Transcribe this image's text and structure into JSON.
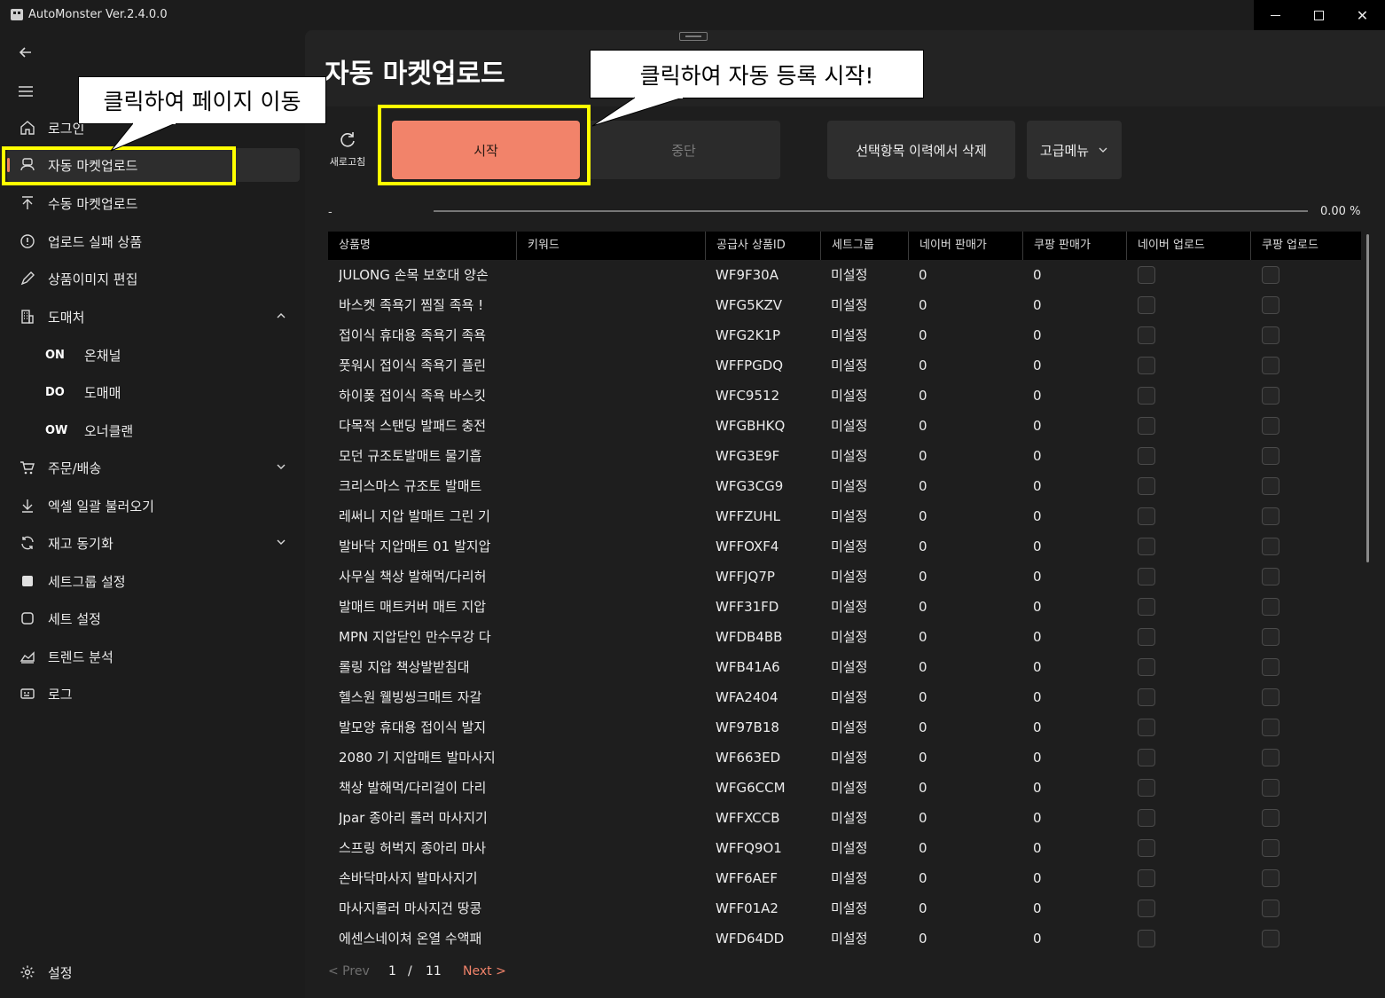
{
  "window": {
    "title": "AutoMonster Ver.2.4.0.0",
    "minimize": "",
    "maximize": "",
    "close": "✕"
  },
  "sidebar": {
    "items": [
      {
        "label": "로그인",
        "icon": "home-icon"
      },
      {
        "label": "자동 마켓업로드",
        "icon": "auto-upload-icon"
      },
      {
        "label": "수동 마켓업로드",
        "icon": "upload-arrow-icon"
      },
      {
        "label": "업로드 실패 상품",
        "icon": "alert-circle-icon"
      },
      {
        "label": "상품이미지 편집",
        "icon": "pencil-icon"
      },
      {
        "label": "도매처",
        "icon": "building-icon"
      },
      {
        "label": "주문/배송",
        "icon": "cart-icon"
      },
      {
        "label": "엑셀 일괄 불러오기",
        "icon": "download-arrow-icon"
      },
      {
        "label": "재고 동기화",
        "icon": "sync-icon"
      },
      {
        "label": "세트그룹 설정",
        "icon": "square-filled-icon"
      },
      {
        "label": "세트 설정",
        "icon": "square-outline-icon"
      },
      {
        "label": "트렌드 분석",
        "icon": "area-chart-icon"
      },
      {
        "label": "로그",
        "icon": "log-icon"
      }
    ],
    "wholesale_sub": [
      {
        "code": "ON",
        "label": "온채널"
      },
      {
        "code": "DO",
        "label": "도매매"
      },
      {
        "code": "OW",
        "label": "오너클랜"
      }
    ],
    "settings_label": "설정"
  },
  "main": {
    "title": "자동 마켓업로드",
    "refresh_label": "새로고침",
    "buttons": {
      "start": "시작",
      "stop": "중단",
      "delete_history": "선택항목 이력에서 삭제",
      "advanced_menu": "고급메뉴"
    },
    "progress": {
      "status": "-",
      "percent_text": "0.00 %",
      "fraction": 0
    },
    "table": {
      "columns": [
        "상품명",
        "키워드",
        "공급사 상품ID",
        "세트그룹",
        "네이버 판매가",
        "쿠팡 판매가",
        "네이버 업로드",
        "쿠팡 업로드"
      ],
      "rows": [
        {
          "name": "JULONG 손목 보호대 양손",
          "keyword": "",
          "id": "WF9F30A",
          "group": "미설정",
          "naver_price": "0",
          "coupang_price": "0"
        },
        {
          "name": "바스켓 족욕기 찜질 족욕 !",
          "keyword": "",
          "id": "WFG5KZV",
          "group": "미설정",
          "naver_price": "0",
          "coupang_price": "0"
        },
        {
          "name": "접이식 휴대용 족욕기 족욕",
          "keyword": "",
          "id": "WFG2K1P",
          "group": "미설정",
          "naver_price": "0",
          "coupang_price": "0"
        },
        {
          "name": "풋워시 접이식 족욕기 플린",
          "keyword": "",
          "id": "WFFPGDQ",
          "group": "미설정",
          "naver_price": "0",
          "coupang_price": "0"
        },
        {
          "name": "하이퐂 접이식 족욕 바스킷",
          "keyword": "",
          "id": "WFC9512",
          "group": "미설정",
          "naver_price": "0",
          "coupang_price": "0"
        },
        {
          "name": "다목적 스탠딩 발패드 충전",
          "keyword": "",
          "id": "WFGBHKQ",
          "group": "미설정",
          "naver_price": "0",
          "coupang_price": "0"
        },
        {
          "name": "모던 규조토발매트 물기흡",
          "keyword": "",
          "id": "WFG3E9F",
          "group": "미설정",
          "naver_price": "0",
          "coupang_price": "0"
        },
        {
          "name": "크리스마스 규조토 발매트",
          "keyword": "",
          "id": "WFG3CG9",
          "group": "미설정",
          "naver_price": "0",
          "coupang_price": "0"
        },
        {
          "name": "레써니 지압 발매트 그린 기",
          "keyword": "",
          "id": "WFFZUHL",
          "group": "미설정",
          "naver_price": "0",
          "coupang_price": "0"
        },
        {
          "name": "발바닥 지압매트 01 발지압",
          "keyword": "",
          "id": "WFFOXF4",
          "group": "미설정",
          "naver_price": "0",
          "coupang_price": "0"
        },
        {
          "name": "사무실 책상 발해먹/다리허",
          "keyword": "",
          "id": "WFFJQ7P",
          "group": "미설정",
          "naver_price": "0",
          "coupang_price": "0"
        },
        {
          "name": "발매트 매트커버 매트 지압",
          "keyword": "",
          "id": "WFF31FD",
          "group": "미설정",
          "naver_price": "0",
          "coupang_price": "0"
        },
        {
          "name": "MPN 지압닫인 만수무강 다",
          "keyword": "",
          "id": "WFDB4BB",
          "group": "미설정",
          "naver_price": "0",
          "coupang_price": "0"
        },
        {
          "name": "롤링 지압 책상발받침대",
          "keyword": "",
          "id": "WFB41A6",
          "group": "미설정",
          "naver_price": "0",
          "coupang_price": "0"
        },
        {
          "name": "헬스원 웰빙씽크매트 자갈",
          "keyword": "",
          "id": "WFA2404",
          "group": "미설정",
          "naver_price": "0",
          "coupang_price": "0"
        },
        {
          "name": "발모양 휴대용 접이식 발지",
          "keyword": "",
          "id": "WF97B18",
          "group": "미설정",
          "naver_price": "0",
          "coupang_price": "0"
        },
        {
          "name": "2080 기 지압매트 발마사지",
          "keyword": "",
          "id": "WF663ED",
          "group": "미설정",
          "naver_price": "0",
          "coupang_price": "0"
        },
        {
          "name": "책상 발해먹/다리걸이 다리",
          "keyword": "",
          "id": "WFG6CCM",
          "group": "미설정",
          "naver_price": "0",
          "coupang_price": "0"
        },
        {
          "name": "Jpar 종아리 롤러 마사지기",
          "keyword": "",
          "id": "WFFXCCB",
          "group": "미설정",
          "naver_price": "0",
          "coupang_price": "0"
        },
        {
          "name": "스프링 허벅지 종아리 마사",
          "keyword": "",
          "id": "WFFQ9O1",
          "group": "미설정",
          "naver_price": "0",
          "coupang_price": "0"
        },
        {
          "name": "손바닥마사지 발마사지기",
          "keyword": "",
          "id": "WFF6AEF",
          "group": "미설정",
          "naver_price": "0",
          "coupang_price": "0"
        },
        {
          "name": "마사지롤러 마사지건 땅콩",
          "keyword": "",
          "id": "WFF01A2",
          "group": "미설정",
          "naver_price": "0",
          "coupang_price": "0"
        },
        {
          "name": "에센스네이쳐 온열 수액패",
          "keyword": "",
          "id": "WFD64DD",
          "group": "미설정",
          "naver_price": "0",
          "coupang_price": "0"
        }
      ]
    },
    "pagination": {
      "prev": "< Prev",
      "current": "1",
      "separator": "/",
      "total": "11",
      "next": "Next >"
    }
  },
  "annotations": {
    "callout_nav": "클릭하여 페이지 이동",
    "callout_start": "클릭하여 자동 등록 시작!",
    "highlight_color": "#ffff00"
  },
  "colors": {
    "accent": "#f2836a",
    "background": "#1c1c1c",
    "table_header": "#000000"
  }
}
